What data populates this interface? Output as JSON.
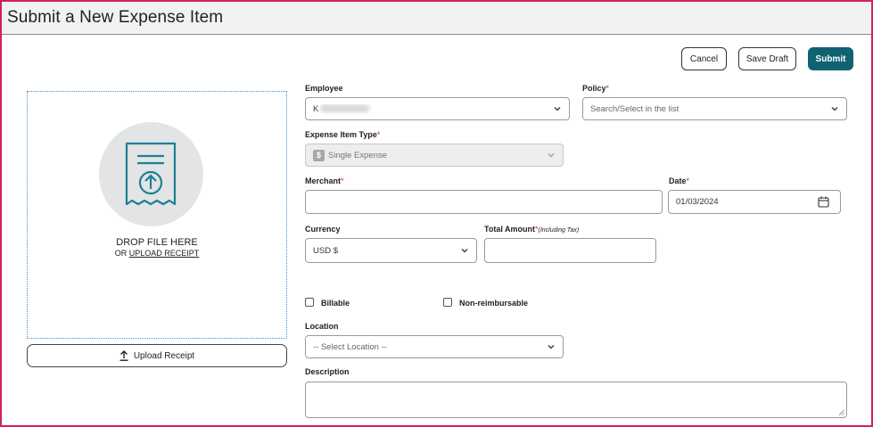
{
  "page": {
    "title": "Submit a New Expense Item"
  },
  "actions": {
    "cancel": "Cancel",
    "save_draft": "Save Draft",
    "submit": "Submit"
  },
  "receipt": {
    "drop_title": "DROP FILE HERE",
    "drop_or": "OR",
    "drop_link": "UPLOAD RECEIPT",
    "upload_button": "Upload Receipt"
  },
  "form": {
    "employee": {
      "label": "Employee",
      "value": "K"
    },
    "policy": {
      "label": "Policy",
      "required": "*",
      "placeholder": "Search/Select in the list"
    },
    "expense_type": {
      "label": "Expense Item Type",
      "required": "*",
      "value": "Single Expense",
      "icon": "$"
    },
    "merchant": {
      "label": "Merchant",
      "required": "*",
      "value": ""
    },
    "date": {
      "label": "Date",
      "required": "*",
      "value": "01/03/2024"
    },
    "currency": {
      "label": "Currency",
      "value": "USD $"
    },
    "total_amount": {
      "label": "Total Amount",
      "required": "*",
      "hint": "(Including Tax)",
      "value": ""
    },
    "billable": {
      "label": "Billable",
      "checked": false
    },
    "non_reimbursable": {
      "label": "Non-reimbursable",
      "checked": false
    },
    "location": {
      "label": "Location",
      "value": "-- Select Location --"
    },
    "description": {
      "label": "Description",
      "value": ""
    }
  },
  "colors": {
    "accent": "#0f6272",
    "frame": "#d3215a",
    "required": "#d3215a"
  }
}
